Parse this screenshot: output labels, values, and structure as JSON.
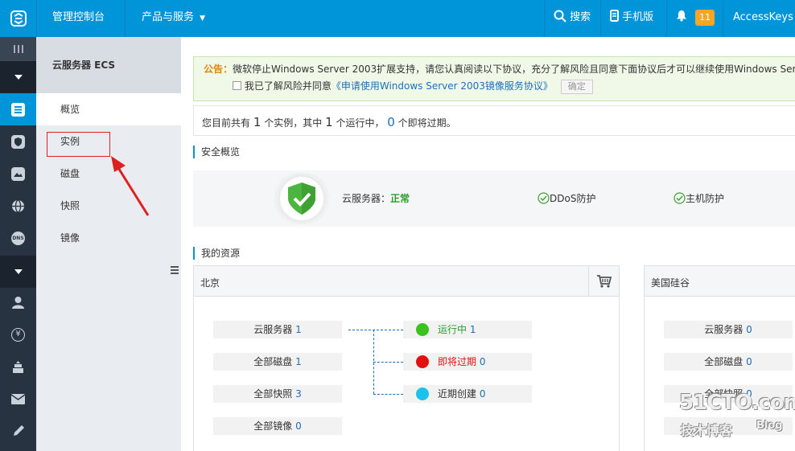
{
  "topbar": {
    "console_label": "管理控制台",
    "products_label": "产品与服务",
    "search_label": "搜索",
    "mobile_label": "手机版",
    "notification_count": "11",
    "accesskeys_label": "AccessKeys"
  },
  "rail": {
    "items": [
      "logo-icon",
      "menu-lines-icon",
      "caret-down-icon",
      "ecs-icon",
      "shield-icon",
      "image-icon",
      "globe-icon",
      "dns-icon",
      "caret-down-icon",
      "user-icon",
      "yen-icon",
      "package-icon",
      "mail-icon",
      "pencil-icon"
    ],
    "dns_text": "DNS",
    "yen_text": "¥"
  },
  "sidebar": {
    "header": "云服务器 ECS",
    "items": [
      {
        "label": "概览",
        "active": true
      },
      {
        "label": "实例",
        "active": false
      },
      {
        "label": "磁盘",
        "active": false
      },
      {
        "label": "快照",
        "active": false
      },
      {
        "label": "镜像",
        "active": false
      }
    ]
  },
  "notice": {
    "label": "公告：",
    "text": "微软停止Windows Server 2003扩展支持，请您认真阅读以下协议，充分了解风险且同意下面协议后才可以继续使用Windows Server",
    "checkbox_label": "我已了解风险并同意",
    "agreement_link": "《申请使用Windows Server 2003镜像服务协议》",
    "ok_button": "确定"
  },
  "summary": {
    "part1": "您目前共有",
    "total": "1",
    "part2": "个实例，其中",
    "running": "1",
    "part3": "个运行中，",
    "expiring": "0",
    "part4": "个即将过期。"
  },
  "security": {
    "title": "安全概览",
    "server_label": "云服务器：",
    "server_status": "正常",
    "ddos_label": "DDoS防护",
    "host_label": "主机防护"
  },
  "resources": {
    "title": "我的资源",
    "regions": [
      {
        "name": "北京",
        "stats": [
          {
            "label": "云服务器",
            "value": "1"
          },
          {
            "label": "全部磁盘",
            "value": "1"
          },
          {
            "label": "全部快照",
            "value": "3"
          },
          {
            "label": "全部镜像",
            "value": "0"
          }
        ],
        "status": [
          {
            "label": "运行中",
            "value": "1",
            "color": "#3cc21e",
            "label_color": "#2e9b2e"
          },
          {
            "label": "即将过期",
            "value": "0",
            "color": "#e31010",
            "label_color": "#e31010"
          },
          {
            "label": "近期创建",
            "value": "0",
            "color": "#1bc3ec",
            "label_color": "#333333"
          }
        ]
      },
      {
        "name": "美国硅谷",
        "stats": [
          {
            "label": "云服务器",
            "value": "0"
          },
          {
            "label": "全部磁盘",
            "value": "0"
          },
          {
            "label": "全部快照",
            "value": "0"
          }
        ]
      }
    ]
  },
  "watermark": {
    "site": "51CTO.com",
    "sub": "技术博客",
    "blog": "Blog"
  },
  "colors": {
    "accent": "#0095d9",
    "rail": "#283341",
    "annotation": "#e02020"
  }
}
